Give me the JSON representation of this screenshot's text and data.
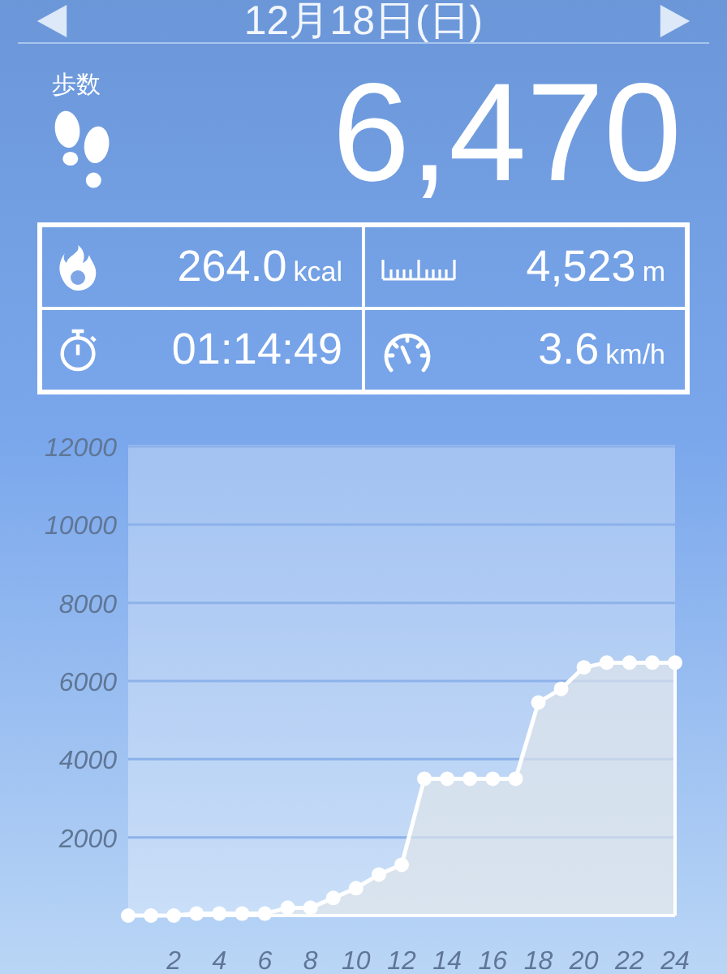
{
  "header": {
    "title": "12月18日(日)"
  },
  "steps": {
    "label": "歩数",
    "value": "6,470"
  },
  "stats": [
    {
      "kind": "calories",
      "value": "264.0",
      "unit": "kcal"
    },
    {
      "kind": "distance",
      "value": "4,523",
      "unit": "m"
    },
    {
      "kind": "time",
      "value": "01:14:49"
    },
    {
      "kind": "speed",
      "value": "3.6",
      "unit": "km/h"
    }
  ],
  "chart": {
    "chart_data": {
      "type": "area",
      "x": [
        0,
        1,
        2,
        3,
        4,
        5,
        6,
        7,
        8,
        9,
        10,
        11,
        12,
        13,
        14,
        15,
        16,
        17,
        18,
        19,
        20,
        21,
        22,
        23,
        24
      ],
      "values": [
        0,
        0,
        0,
        50,
        50,
        50,
        50,
        200,
        200,
        450,
        700,
        1050,
        1300,
        3500,
        3500,
        3500,
        3500,
        3500,
        5450,
        5800,
        6350,
        6470,
        6470,
        6470,
        6470
      ],
      "xlim": [
        0,
        24
      ],
      "ylim": [
        0,
        12000
      ],
      "grid": true,
      "xticks": [
        2,
        4,
        6,
        8,
        10,
        12,
        14,
        16,
        18,
        20,
        22,
        24
      ],
      "yticks": [
        2000,
        4000,
        6000,
        8000,
        10000,
        12000
      ]
    }
  }
}
